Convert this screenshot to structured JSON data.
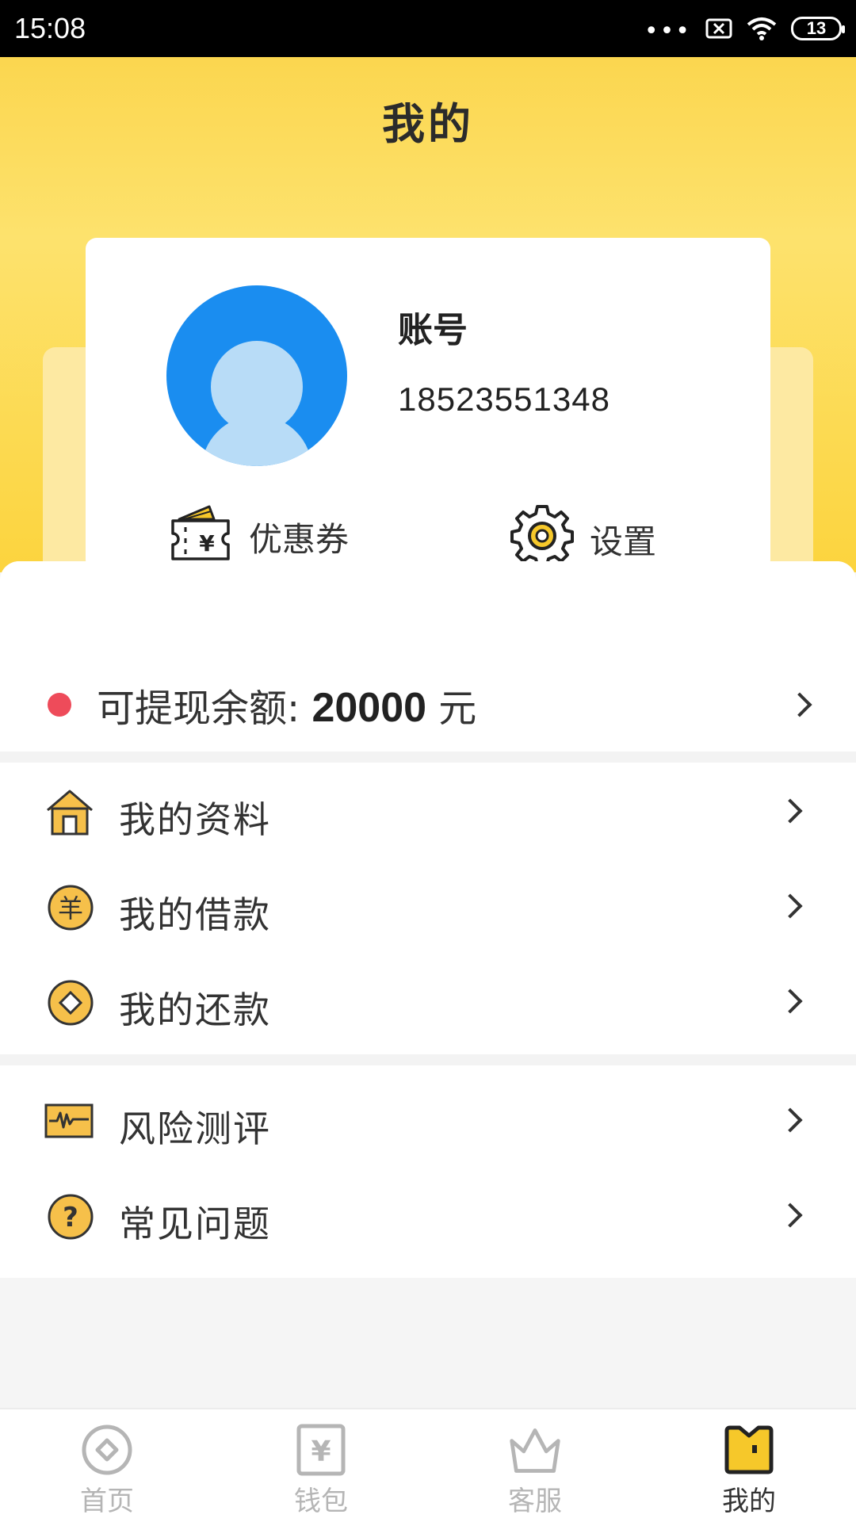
{
  "status_bar": {
    "time": "15:08",
    "dots": "•••",
    "battery": "13"
  },
  "header": {
    "title": "我的"
  },
  "profile": {
    "account_label": "账号",
    "account_value": "18523551348",
    "coupon_label": "优惠券",
    "settings_label": "设置"
  },
  "balance": {
    "label": "可提现余额: ",
    "amount": "20000",
    "unit": " 元"
  },
  "menu_group_1": [
    {
      "label": "我的资料",
      "icon": "house-icon"
    },
    {
      "label": "我的借款",
      "icon": "yuan-coin-icon"
    },
    {
      "label": "我的还款",
      "icon": "diamond-coin-icon"
    }
  ],
  "menu_group_2": [
    {
      "label": "风险测评",
      "icon": "pulse-chart-icon"
    },
    {
      "label": "常见问题",
      "icon": "question-icon"
    }
  ],
  "bottom_nav": [
    {
      "label": "首页",
      "icon": "home-compass-icon",
      "active": false
    },
    {
      "label": "钱包",
      "icon": "wallet-yuan-icon",
      "active": false
    },
    {
      "label": "客服",
      "icon": "crown-icon",
      "active": false
    },
    {
      "label": "我的",
      "icon": "profile-folder-icon",
      "active": true
    }
  ],
  "colors": {
    "accent_yellow": "#fcd43e",
    "avatar_blue": "#1a8df0",
    "alert_red": "#ee4b5a",
    "inactive_gray": "#b5b5b5"
  }
}
